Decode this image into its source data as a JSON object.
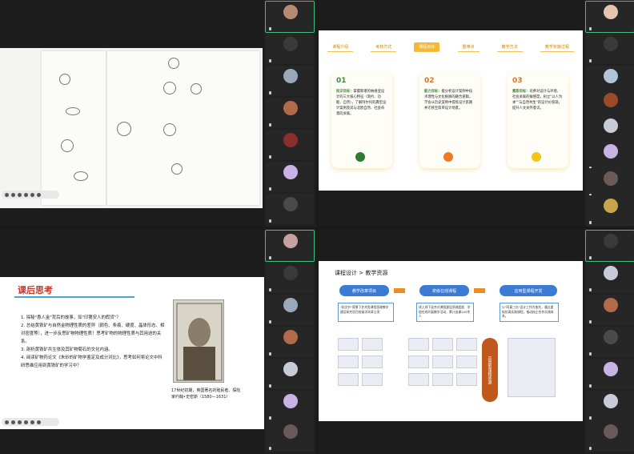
{
  "q1": {
    "status": [
      "",
      "",
      ""
    ],
    "participants": [
      {
        "name": "",
        "color": "#b98a72"
      },
      {
        "name": "",
        "color": "#3a3a3a"
      },
      {
        "name": "",
        "color": "#9aa9b8"
      },
      {
        "name": "",
        "color": "#b26a4a"
      },
      {
        "name": "",
        "color": "#8a2e2e"
      },
      {
        "name": "",
        "color": "#c9b3e6"
      },
      {
        "name": "",
        "color": "#4a4a4a"
      }
    ]
  },
  "q2": {
    "tabs": [
      "课程介绍",
      "考核方式",
      "课程目标",
      "重难点",
      "教学方法",
      "教学实施过程"
    ],
    "cards": [
      {
        "num": "01",
        "label": "知识目标：",
        "text": "掌握斯堪的纳维亚设计的三大核心特征（简约、功能、自然），了解阿尔托的典型设计案例及其与北欧自然、社会背景的关联。"
      },
      {
        "num": "02",
        "label": "能力目标：",
        "text": "能分析设计案例中技术理性与文化根脉的融合逻辑，学会从历史案例中提炼设计思路并迁移至简单设计场景。"
      },
      {
        "num": "03",
        "label": "素质目标：",
        "text": "培养对设计与环境、社会关联的敏感度，树立\"以人为本\"\"与自然共生\"的设计价值观，提升人文关怀意识。"
      }
    ],
    "status": "",
    "participants": [
      {
        "name": "",
        "color": "#e7c3b0"
      },
      {
        "name": "",
        "color": "#3a3a3a"
      },
      {
        "name": "",
        "color": "#b0c4d8"
      },
      {
        "name": "",
        "color": "#9b4a2a"
      },
      {
        "name": "",
        "color": "#c8ccd8"
      },
      {
        "name": "",
        "color": "#c9b3e6"
      },
      {
        "name": "",
        "color": "#6a5a5a"
      },
      {
        "name": "",
        "color": "#c8a54a"
      }
    ]
  },
  "q3": {
    "title": "课后思考",
    "items": [
      "1. 探秘\"愚人金\"背后的故事，如\"印第安人的假货\"？",
      "2. 总结黄铁矿与自然金物理性质的差异（颜色、条痕、硬度、晶体形态、相对密度等），进一步反思矿物物理性质！思考矿物的物理性质与其用途的关系。",
      "3. 剖析黄铁矿共生体及其矿物菊石的文化内涵。",
      "4. 阅读矿物药论文《朱砂的矿物学鉴定及成分对比》，思考如何将论文中科研思维应用到黄铁矿的学习中？"
    ],
    "caption": "17世纪初期，英国著名的殖民者、探险家约翰•史密斯（1580—1631）",
    "participants": [
      {
        "name": "",
        "color": "#c8a0a0"
      },
      {
        "name": "",
        "color": "#3a3a3a"
      },
      {
        "name": "",
        "color": "#9aa9b8"
      },
      {
        "name": "",
        "color": "#b26a4a"
      },
      {
        "name": "",
        "color": "#c8ccd8"
      },
      {
        "name": "",
        "color": "#c9b3e6"
      },
      {
        "name": "",
        "color": "#6a5a5a"
      }
    ]
  },
  "q4": {
    "breadcrumb": "课程设计 > 教学资源",
    "steps": [
      "教学改革项目",
      "校级在线课程",
      "应用型课程开发"
    ],
    "boxes": [
      "\"彩文针\"背景下艺术类课程思政教学建设研究项目校级学改革立项",
      "线上线下混合式课程建设资源超星、学银在线开展教学活动，累计选课200余人",
      "以\"四真三化\"设计工作为依托，通过虚拟仿真实践课程，推动校企合作实践体系。"
    ],
    "oval": "应用型课程资源",
    "participants": [
      {
        "name": "",
        "color": "#3a3a3a"
      },
      {
        "name": "",
        "color": "#c8ccd8"
      },
      {
        "name": "",
        "color": "#b26a4a"
      },
      {
        "name": "",
        "color": "#4a4a4a"
      },
      {
        "name": "",
        "color": "#c9b3e6"
      },
      {
        "name": "",
        "color": "#c8ccd8"
      },
      {
        "name": "",
        "color": "#6a5a5a"
      }
    ]
  }
}
